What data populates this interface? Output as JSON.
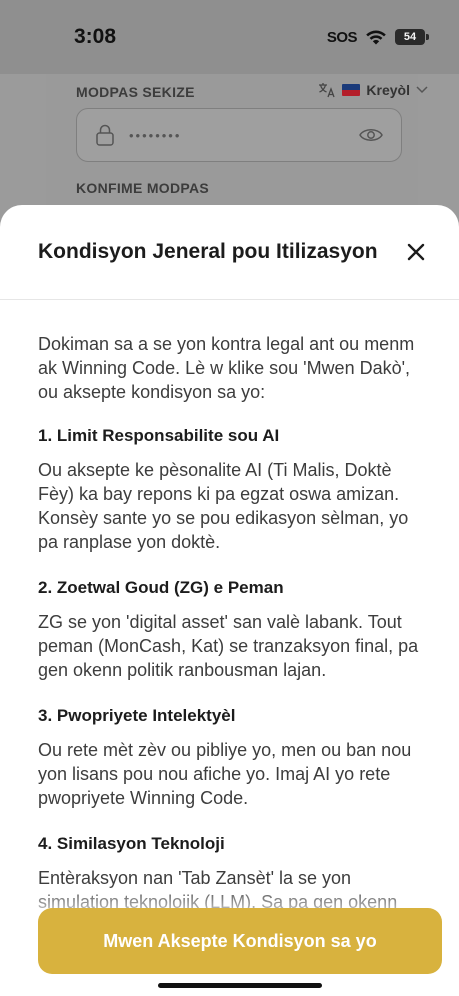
{
  "status_bar": {
    "time": "3:08",
    "sos": "SOS",
    "battery": "54"
  },
  "background_form": {
    "password_label": "MODPAS SEKIZE",
    "password_value": "••••••••",
    "confirm_label": "KONFIME MODPAS",
    "language": "Kreyòl"
  },
  "modal": {
    "title": "Kondisyon Jeneral pou Itilizasyon",
    "intro": "Dokiman sa a se yon kontra legal ant ou menm ak Winning Code. Lè w klike sou 'Mwen Dakò', ou aksepte kondisyon sa yo:",
    "sections": [
      {
        "title": "1. Limit Responsabilite sou AI",
        "text": "Ou aksepte ke pèsonalite AI (Ti Malis, Doktè Fèy) ka bay repons ki pa egzat oswa amizan. Konsèy sante yo se pou edikasyon sèlman, yo pa ranplase yon doktè."
      },
      {
        "title": "2. Zoetwal Goud (ZG) e Peman",
        "text": "ZG se yon 'digital asset' san valè labank. Tout peman (MonCash, Kat) se tranzaksyon final, pa gen okenn politik ranbousman lajan."
      },
      {
        "title": "3. Pwopriyete Intelektyèl",
        "text": "Ou rete mèt zèv ou pibliye yo, men ou ban nou yon lisans pou nou afiche yo. Imaj AI yo rete pwopriyete Winning Code."
      },
      {
        "title": "4. Similasyon Teknoloji",
        "text": "Entèraksyon nan 'Tab Zansèt' la se yon simulation teknolojik (LLM). Sa pa gen okenn"
      }
    ],
    "accept_button": "Mwen Aksepte Kondisyon sa yo"
  }
}
